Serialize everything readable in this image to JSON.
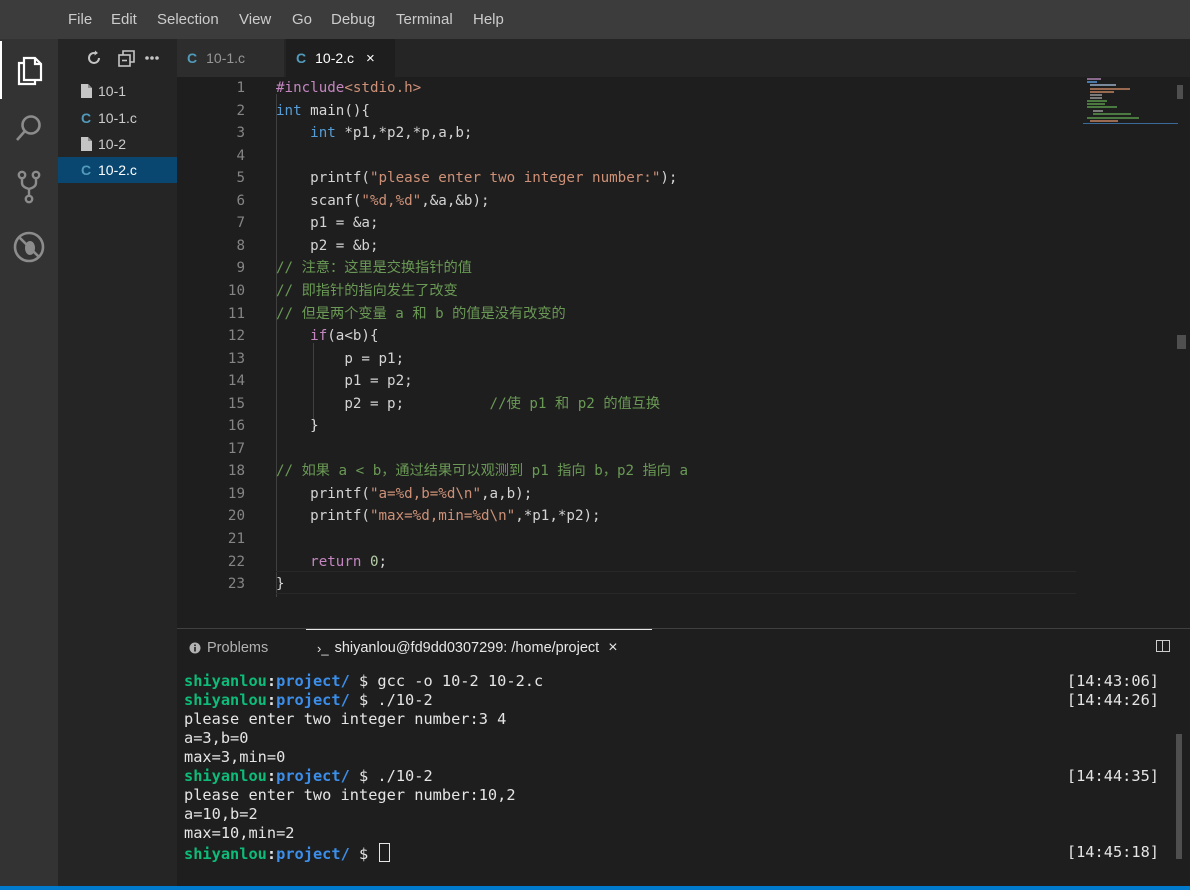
{
  "menu": [
    "File",
    "Edit",
    "Selection",
    "View",
    "Go",
    "Debug",
    "Terminal",
    "Help"
  ],
  "activity_bar": [
    "files-icon",
    "search-icon",
    "source-control-icon",
    "debug-icon"
  ],
  "explorer": {
    "tools": [
      "refresh-icon",
      "collapse-all-icon",
      "more-icon"
    ],
    "files": [
      {
        "name": "10-1",
        "icon": "file-icon",
        "selected": false
      },
      {
        "name": "10-1.c",
        "icon": "c-file-icon",
        "selected": false
      },
      {
        "name": "10-2",
        "icon": "file-icon",
        "selected": false
      },
      {
        "name": "10-2.c",
        "icon": "c-file-icon",
        "selected": true
      }
    ]
  },
  "tabs": [
    {
      "label": "10-1.c",
      "active": false
    },
    {
      "label": "10-2.c",
      "active": true
    }
  ],
  "close_glyph": "×",
  "c_icon_letter": "C",
  "editor": {
    "lines": [
      [
        {
          "t": "pp",
          "v": "#include"
        },
        {
          "t": "str",
          "v": "<stdio.h>"
        }
      ],
      [
        {
          "t": "kw",
          "v": "int"
        },
        {
          "t": "",
          "v": " main(){"
        }
      ],
      [
        {
          "t": "",
          "v": "    "
        },
        {
          "t": "kw",
          "v": "int"
        },
        {
          "t": "",
          "v": " *p1,*p2,*p,a,b;"
        }
      ],
      [],
      [
        {
          "t": "",
          "v": "    printf("
        },
        {
          "t": "str",
          "v": "\"please enter two integer number:\""
        },
        {
          "t": "",
          "v": ");"
        }
      ],
      [
        {
          "t": "",
          "v": "    scanf("
        },
        {
          "t": "str",
          "v": "\"%d,%d\""
        },
        {
          "t": "",
          "v": ",&a,&b);"
        }
      ],
      [
        {
          "t": "",
          "v": "    p1 = &a;"
        }
      ],
      [
        {
          "t": "",
          "v": "    p2 = &b;"
        }
      ],
      [
        {
          "t": "cm",
          "v": "// 注意：这里是交换指针的值"
        }
      ],
      [
        {
          "t": "cm",
          "v": "// 即指针的指向发生了改变"
        }
      ],
      [
        {
          "t": "cm",
          "v": "// 但是两个变量 a 和 b 的值是没有改变的"
        }
      ],
      [
        {
          "t": "",
          "v": "    "
        },
        {
          "t": "pp",
          "v": "if"
        },
        {
          "t": "",
          "v": "(a<b){"
        }
      ],
      [
        {
          "t": "",
          "v": "        p = p1;"
        }
      ],
      [
        {
          "t": "",
          "v": "        p1 = p2;"
        }
      ],
      [
        {
          "t": "",
          "v": "        p2 = p;          "
        },
        {
          "t": "cm",
          "v": "//使 p1 和 p2 的值互换"
        }
      ],
      [
        {
          "t": "",
          "v": "    }"
        }
      ],
      [],
      [
        {
          "t": "cm",
          "v": "// 如果 a < b，通过结果可以观测到 p1 指向 b，p2 指向 a"
        }
      ],
      [
        {
          "t": "",
          "v": "    printf("
        },
        {
          "t": "str",
          "v": "\"a=%d,b=%d\\n\""
        },
        {
          "t": "",
          "v": ",a,b);"
        }
      ],
      [
        {
          "t": "",
          "v": "    printf("
        },
        {
          "t": "str",
          "v": "\"max=%d,min=%d\\n\""
        },
        {
          "t": "",
          "v": ",*p1,*p2);"
        }
      ],
      [],
      [
        {
          "t": "",
          "v": "    "
        },
        {
          "t": "pp",
          "v": "return"
        },
        {
          "t": "",
          "v": " "
        },
        {
          "t": "nm",
          "v": "0"
        },
        {
          "t": "",
          "v": ";"
        }
      ],
      [
        {
          "t": "",
          "v": "}"
        }
      ]
    ]
  },
  "panel": {
    "problems_label": "Problems",
    "terminal_prompt_glyph": "›_",
    "terminal_tab_label": "shiyanlou@fd9dd0307299: /home/project",
    "terminal": [
      {
        "kind": "prompt",
        "user": "shiyanlou",
        "path": "project/",
        "cmd": " $ gcc -o 10-2 10-2.c",
        "time": "[14:43:06]"
      },
      {
        "kind": "prompt",
        "user": "shiyanlou",
        "path": "project/",
        "cmd": " $ ./10-2",
        "time": "[14:44:26]"
      },
      {
        "kind": "out",
        "text": "please enter two integer number:3 4"
      },
      {
        "kind": "out",
        "text": "a=3,b=0"
      },
      {
        "kind": "out",
        "text": "max=3,min=0"
      },
      {
        "kind": "prompt",
        "user": "shiyanlou",
        "path": "project/",
        "cmd": " $ ./10-2",
        "time": "[14:44:35]"
      },
      {
        "kind": "out",
        "text": "please enter two integer number:10,2"
      },
      {
        "kind": "out",
        "text": "a=10,b=2"
      },
      {
        "kind": "out",
        "text": "max=10,min=2"
      },
      {
        "kind": "prompt",
        "user": "shiyanlou",
        "path": "project/",
        "cmd": " $ ",
        "time": "[14:45:18]",
        "cursor": true
      }
    ]
  },
  "colors": {
    "accent": "#007acc",
    "c_icon": "#519aba",
    "selection": "#094771",
    "prompt_user": "#0dbc79",
    "prompt_path": "#3b8eea"
  }
}
